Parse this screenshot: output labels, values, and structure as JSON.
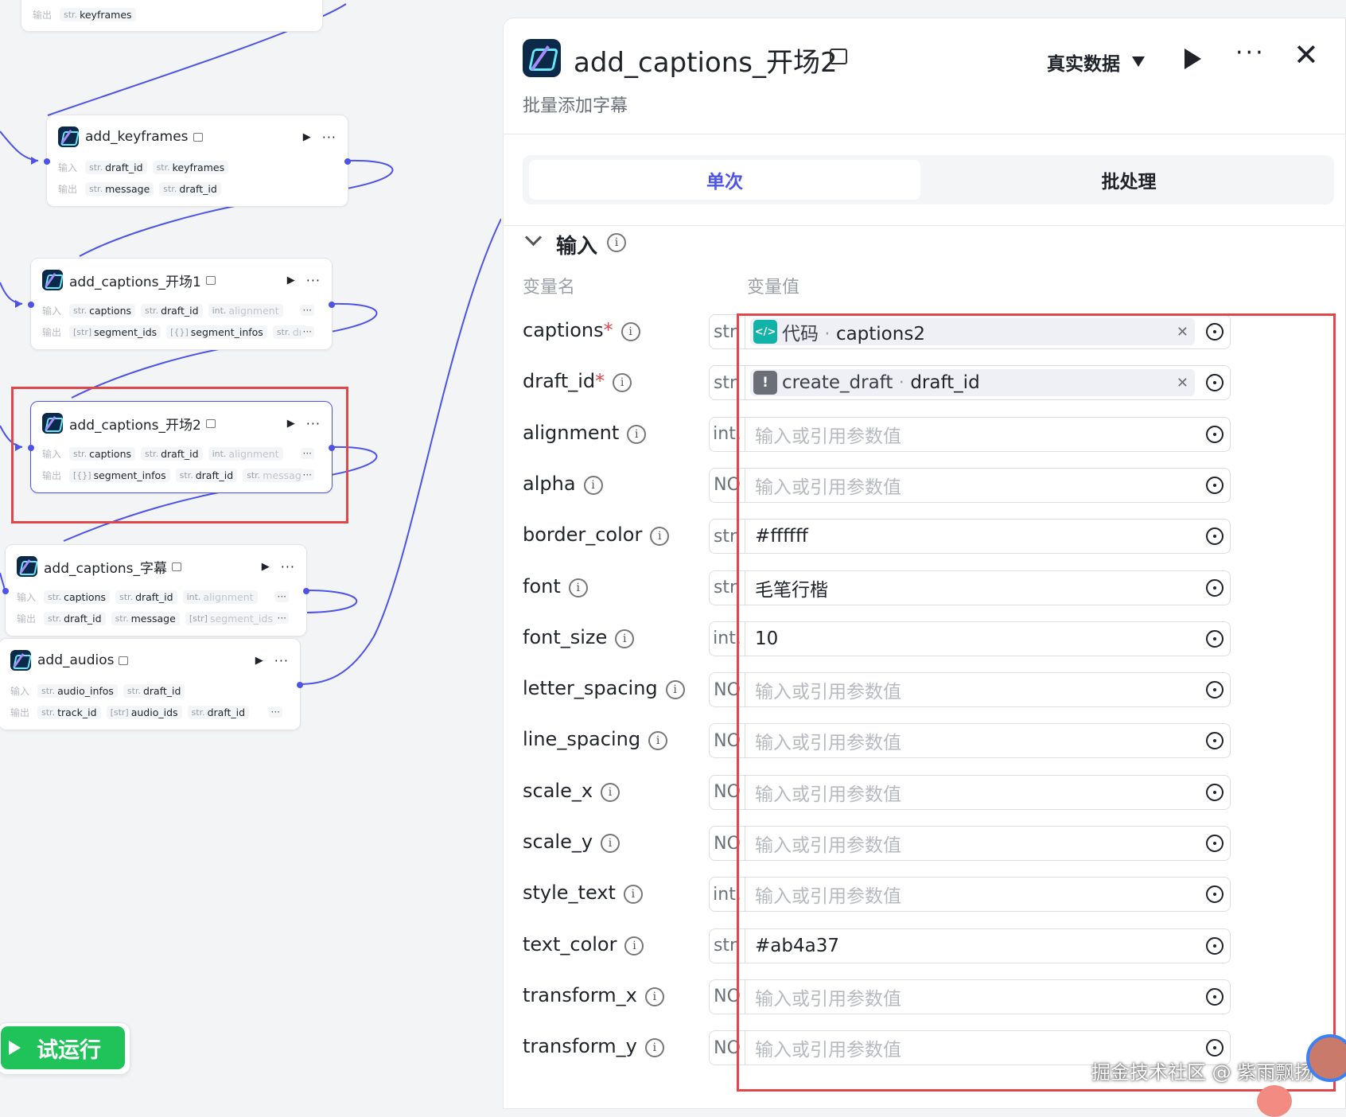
{
  "canvas": {
    "nodes": [
      {
        "id": "prev",
        "title": "",
        "rows": [
          {
            "label": "输出",
            "params": [
              {
                "t": "str.",
                "n": "keyframes"
              }
            ]
          }
        ]
      },
      {
        "id": "add_keyframes",
        "title": "add_keyframes",
        "rows": [
          {
            "label": "输入",
            "params": [
              {
                "t": "str.",
                "n": "draft_id"
              },
              {
                "t": "str.",
                "n": "keyframes"
              }
            ]
          },
          {
            "label": "输出",
            "params": [
              {
                "t": "str.",
                "n": "message"
              },
              {
                "t": "str.",
                "n": "draft_id"
              }
            ]
          }
        ]
      },
      {
        "id": "cap1",
        "title": "add_captions_开场1",
        "rows": [
          {
            "label": "输入",
            "params": [
              {
                "t": "str.",
                "n": "captions"
              },
              {
                "t": "str.",
                "n": "draft_id"
              },
              {
                "t": "int.",
                "n": "alignment"
              }
            ]
          },
          {
            "label": "输出",
            "params": [
              {
                "t": "[str]",
                "n": "segment_ids"
              },
              {
                "t": "[{}]",
                "n": "segment_infos"
              },
              {
                "t": "str.",
                "n": "dr"
              }
            ]
          }
        ]
      },
      {
        "id": "cap2",
        "title": "add_captions_开场2",
        "rows": [
          {
            "label": "输入",
            "params": [
              {
                "t": "str.",
                "n": "captions"
              },
              {
                "t": "str.",
                "n": "draft_id"
              },
              {
                "t": "int.",
                "n": "alignment"
              }
            ]
          },
          {
            "label": "输出",
            "params": [
              {
                "t": "[{}]",
                "n": "segment_infos"
              },
              {
                "t": "str.",
                "n": "draft_id"
              },
              {
                "t": "str.",
                "n": "messag"
              }
            ]
          }
        ]
      },
      {
        "id": "cap3",
        "title": "add_captions_字幕",
        "rows": [
          {
            "label": "输入",
            "params": [
              {
                "t": "str.",
                "n": "captions"
              },
              {
                "t": "str.",
                "n": "draft_id"
              },
              {
                "t": "int.",
                "n": "alignment"
              }
            ]
          },
          {
            "label": "输出",
            "params": [
              {
                "t": "str.",
                "n": "draft_id"
              },
              {
                "t": "str.",
                "n": "message"
              },
              {
                "t": "[str]",
                "n": "segment_ids"
              }
            ]
          }
        ]
      },
      {
        "id": "audios",
        "title": "add_audios",
        "rows": [
          {
            "label": "输入",
            "params": [
              {
                "t": "str.",
                "n": "audio_infos"
              },
              {
                "t": "str.",
                "n": "draft_id"
              }
            ]
          },
          {
            "label": "输出",
            "params": [
              {
                "t": "str.",
                "n": "track_id"
              },
              {
                "t": "[str]",
                "n": "audio_ids"
              },
              {
                "t": "str.",
                "n": "draft_id"
              }
            ]
          }
        ]
      }
    ],
    "run_button_label": "试运行"
  },
  "panel": {
    "title": "add_captions_开场2",
    "subtitle": "批量添加字幕",
    "data_mode": "真实数据",
    "tabs": {
      "single": "单次",
      "batch": "批处理"
    },
    "section_title": "输入",
    "col_name": "变量名",
    "col_value": "变量值",
    "placeholder": "输入或引用参数值",
    "params": [
      {
        "name": "captions",
        "required": true,
        "type": "str.",
        "ref": {
          "kind": "code",
          "node": "代码",
          "key": "captions2"
        }
      },
      {
        "name": "draft_id",
        "required": true,
        "type": "str.",
        "ref": {
          "kind": "draft",
          "node": "create_draft",
          "key": "draft_id"
        }
      },
      {
        "name": "alignment",
        "type": "int.",
        "value": ""
      },
      {
        "name": "alpha",
        "type": "NO",
        "value": ""
      },
      {
        "name": "border_color",
        "type": "str.",
        "value": "#ffffff"
      },
      {
        "name": "font",
        "type": "str.",
        "value": "毛笔行楷"
      },
      {
        "name": "font_size",
        "type": "int.",
        "value": "10"
      },
      {
        "name": "letter_spacing",
        "type": "NO",
        "value": ""
      },
      {
        "name": "line_spacing",
        "type": "NO",
        "value": ""
      },
      {
        "name": "scale_x",
        "type": "NO",
        "value": ""
      },
      {
        "name": "scale_y",
        "type": "NO",
        "value": ""
      },
      {
        "name": "style_text",
        "type": "int.",
        "value": ""
      },
      {
        "name": "text_color",
        "type": "str.",
        "value": "#ab4a37"
      },
      {
        "name": "transform_x",
        "type": "NO",
        "value": ""
      },
      {
        "name": "transform_y",
        "type": "NO",
        "value": ""
      }
    ]
  },
  "watermark": "掘金技术社区 @ 紫雨飘扬",
  "colors": {
    "accent": "#4d53e8",
    "run_green": "#20c35a",
    "highlight": "#e0474a"
  }
}
